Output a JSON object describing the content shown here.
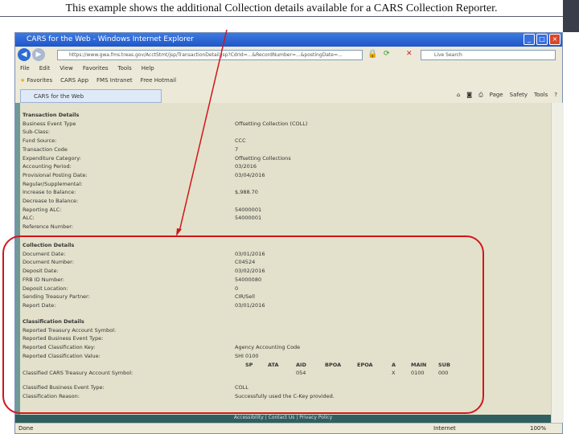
{
  "caption": "This example shows the additional Collection details available for a CARS Collection Reporter.",
  "browser": {
    "title": "CARS for the Web - Windows Internet Explorer",
    "url": "https://www.gwa.fms.treas.gov/AcctStmt/jsp/TransactionDetail.jsp?CdrId=...&RecordNumber=...&postingDate=...",
    "search_placeholder": "Live Search",
    "menu": [
      "File",
      "Edit",
      "View",
      "Favorites",
      "Tools",
      "Help"
    ],
    "favorites": [
      "Favorites",
      "CARS App",
      "FMS Intranet",
      "Free Hotmail"
    ],
    "tab": "CARS for the Web",
    "tools": [
      "Page",
      "Safety",
      "Tools"
    ],
    "footer": "Accessibility | Contact Us | Privacy Policy",
    "status": "Done",
    "zone": "Internet",
    "zoom": "100%"
  },
  "transaction": {
    "heading": "Transaction Details",
    "rows": [
      {
        "label": "Business Event Type",
        "value": "Offsetting Collection (COLL)"
      },
      {
        "label": "Sub-Class:",
        "value": ""
      },
      {
        "label": "Fund Source:",
        "value": "CCC"
      },
      {
        "label": "Transaction Code",
        "value": "7"
      },
      {
        "label": "Expenditure Category:",
        "value": "Offsetting Collections"
      },
      {
        "label": "Accounting Period:",
        "value": "03/2016"
      },
      {
        "label": "Provisional Posting Date:",
        "value": "03/04/2016"
      },
      {
        "label": "Regular/Supplemental:",
        "value": ""
      },
      {
        "label": "Increase to Balance:",
        "value": "$,988.70"
      },
      {
        "label": "Decrease to Balance:",
        "value": ""
      },
      {
        "label": "Reporting ALC:",
        "value": "54000001"
      },
      {
        "label": "ALC:",
        "value": "54000001"
      },
      {
        "label": "Reference Number:",
        "value": ""
      }
    ]
  },
  "collection": {
    "heading": "Collection Details",
    "rows": [
      {
        "label": "Document Date:",
        "value": "03/01/2016"
      },
      {
        "label": "Document Number:",
        "value": "C04524"
      },
      {
        "label": "Deposit Date:",
        "value": "03/02/2016"
      },
      {
        "label": "FRB ID Number:",
        "value": "54000080"
      },
      {
        "label": "Deposit Location:",
        "value": "0"
      },
      {
        "label": "Sending Treasury Partner:",
        "value": "CIR/Sell"
      },
      {
        "label": "Report Date:",
        "value": "03/01/2016"
      }
    ]
  },
  "classification": {
    "heading": "Classification Details",
    "rows": [
      {
        "label": "Reported Treasury Account Symbol:",
        "value": ""
      },
      {
        "label": "Reported Business Event Type:",
        "value": ""
      },
      {
        "label": "Reported Classification Key:",
        "value": "Agency Accounting Code"
      },
      {
        "label": "Reported Classification Value:",
        "value": "SHI 0100"
      }
    ],
    "tas_label": "Classified CARS Treasury Account Symbol:",
    "tas_headers": [
      "SP",
      "ATA",
      "AID",
      "BPOA",
      "EPOA",
      "A",
      "MAIN",
      "SUB"
    ],
    "tas_values": [
      "",
      "",
      "054",
      "",
      "",
      "X",
      "0100",
      "000"
    ],
    "rows2": [
      {
        "label": "Classified Business Event Type:",
        "value": "COLL"
      },
      {
        "label": "Classification Reason:",
        "value": "Successfully used the C-Key provided."
      }
    ]
  },
  "colors": {
    "annotation": "#d0161c",
    "content_bg": "#e3e1cb"
  }
}
